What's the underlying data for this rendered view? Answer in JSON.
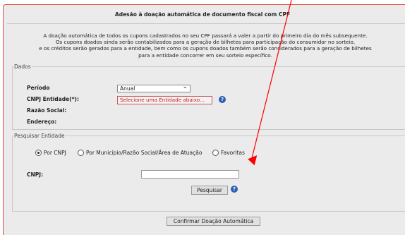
{
  "title": "Adesão à doação automática de documento fiscal com CPF",
  "notice": {
    "line1": "A doação automática de todos os cupons cadastrados no seu CPF passará a valer a partir do primeiro dia do mês subsequente.",
    "line2": "Os cupons doados ainda serão contabilizados para a geração de bilhetes para participação do consumidor no sorteio,",
    "line3": "e os créditos serão gerados para a entidade, bem como os cupons doados também serão considerados para a geração de bilhetes",
    "line4": "para a entidade concorrer em seu sorteio específico."
  },
  "dados": {
    "legend": "Dados",
    "periodo_label": "Período",
    "periodo_value": "Anual",
    "cnpj_label": "CNPJ Entidade(*):",
    "entidade_button": "Selecione uma Entidade abaixo...",
    "razao_label": "Razão Social:",
    "endereco_label": "Endereço:"
  },
  "pesquisar_entidade": {
    "legend": "Pesquisar Entidade",
    "option_cnpj": "Por CNPJ",
    "option_municipio": "Por Município/Razão Social/Área de Atuação",
    "option_favoritas": "Favoritas",
    "selected_option": "Por CNPJ",
    "cnpj_label": "CNPJ:",
    "cnpj_value": "",
    "search_button": "Pesquisar"
  },
  "confirm_button": "Confirmar Doação Automática",
  "help_glyph": "?",
  "colors": {
    "frame_border": "#e44d3a",
    "arrow": "#ff0000",
    "help_icon": "#2b5fb3",
    "entidade_text": "#d11a1a"
  }
}
